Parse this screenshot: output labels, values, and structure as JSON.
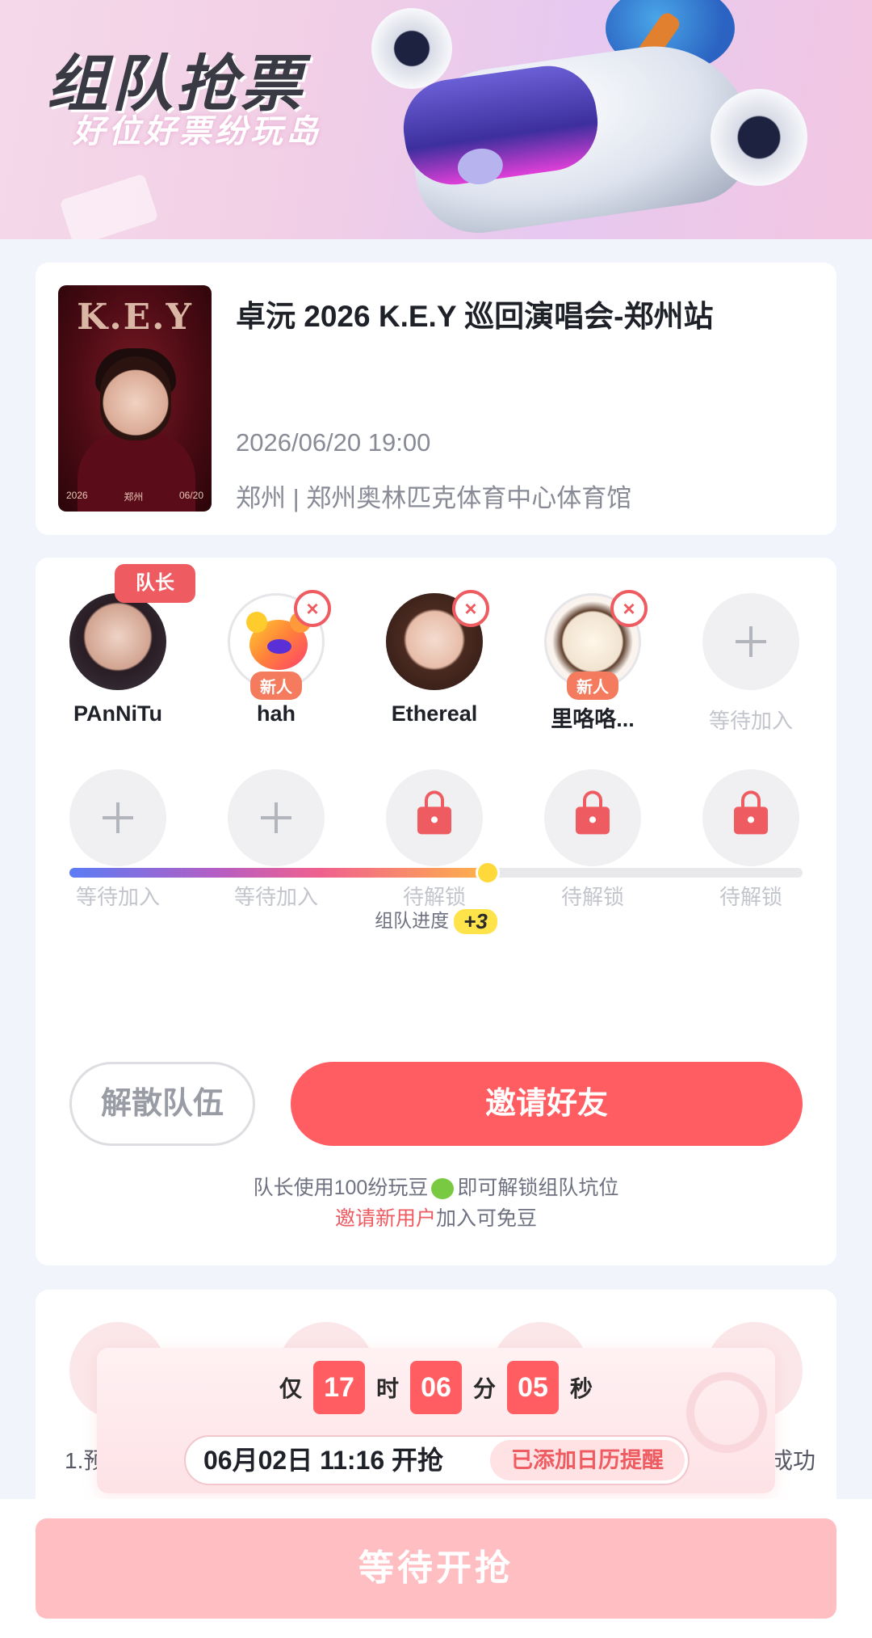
{
  "banner": {
    "title": "组队抢票",
    "subtitle": "好位好票纷玩岛"
  },
  "event": {
    "poster_logo": "K.E.Y",
    "poster_city": "郑州",
    "poster_year": "2026",
    "poster_date": "06/20",
    "title": "卓沅 2026 K.E.Y 巡回演唱会-郑州站",
    "datetime": "2026/06/20 19:00",
    "venue": "郑州 | 郑州奥林匹克体育中心体育馆"
  },
  "team": {
    "captain_label": "队长",
    "new_label": "新人",
    "remove_symbol": "×",
    "members": [
      {
        "name": "PAnNiTu"
      },
      {
        "name": "hah"
      },
      {
        "name": "Ethereal"
      },
      {
        "name": "里咯咯..."
      }
    ],
    "waiting_label": "等待加入",
    "locked_label": "待解锁",
    "progress_label": "组队进度",
    "progress_bonus": "+3",
    "progress_fraction": 0.57,
    "dissolve_button": "解散队伍",
    "invite_button": "邀请好友",
    "hint_part1": "队长使用100纷玩豆",
    "hint_part2": "即可解锁组队坑位",
    "hint_red": "邀请新用户",
    "hint_rest": "加入可免豆"
  },
  "steps": {
    "step1_text": "1.预",
    "step_last_text": "成功"
  },
  "countdown": {
    "prefix": "仅",
    "hours": "17",
    "hours_unit": "时",
    "minutes": "06",
    "minutes_unit": "分",
    "seconds": "05",
    "seconds_unit": "秒",
    "start_text": "06月02日 11:16 开抢",
    "calendar_label": "已添加日历提醒"
  },
  "bottom": {
    "wait_button": "等待开抢"
  },
  "colors": {
    "accent": "#ff5d62",
    "page_bg": "#f1f4fb"
  }
}
